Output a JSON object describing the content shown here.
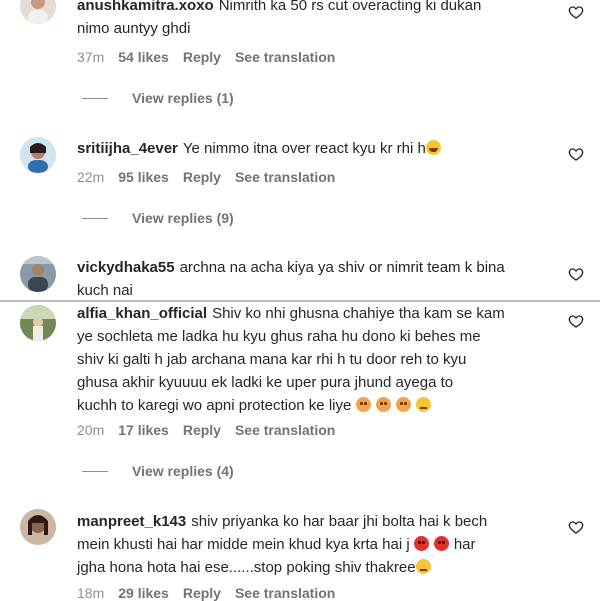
{
  "comments": [
    {
      "username": "anushkamitra.xoxo",
      "lines": [
        "Nimrith ka 50 rs cut overacting ki dukan",
        "nimo auntyy ghdi"
      ],
      "time": "37m",
      "likes": "54 likes",
      "reply": "Reply",
      "translation": "See translation",
      "view_replies": "View replies (1)"
    },
    {
      "username": "sritiijha_4ever",
      "lines": [
        "Ye nimmo itna over react kyu kr rhi h"
      ],
      "time": "22m",
      "likes": "95 likes",
      "reply": "Reply",
      "translation": "See translation",
      "view_replies": "View replies (9)"
    },
    {
      "username": "vickydhaka55",
      "lines": [
        "archna na acha kiya ya shiv or nimrit team k bina",
        "kuch nai"
      ]
    },
    {
      "username": "alfia_khan_official",
      "lines": [
        "Shiv ko nhi ghusna chahiye tha kam se kam",
        "ye sochleta me ladka hu kyu ghus raha hu dono ki behes me",
        "shiv ki galti h jab archana mana kar rhi h tu door reh to kyu",
        "ghusa akhir kyuuuu ek ladki ke uper pura jhund ayega to",
        "kuchh to karegi wo apni protection ke liye"
      ],
      "time": "20m",
      "likes": "17 likes",
      "reply": "Reply",
      "translation": "See translation",
      "view_replies": "View replies (4)"
    },
    {
      "username": "manpreet_k143",
      "lines": [
        "shiv priyanka ko har baar jhi bolta hai k bech",
        "mein khusti hai har midde mein khud kya krta hai j",
        "jgha hona hota hai ese......stop poking shiv thakree"
      ],
      "line2_tail": "har",
      "time": "18m",
      "likes": "29 likes",
      "reply": "Reply",
      "translation": "See translation"
    }
  ],
  "icons": {
    "like": "heart-outline-icon",
    "emoji_laugh": "tears-of-joy-emoji",
    "emoji_angry": "angry-face-emoji",
    "emoji_red": "pouting-face-emoji",
    "emoji_sweat": "anxious-sweat-emoji"
  }
}
